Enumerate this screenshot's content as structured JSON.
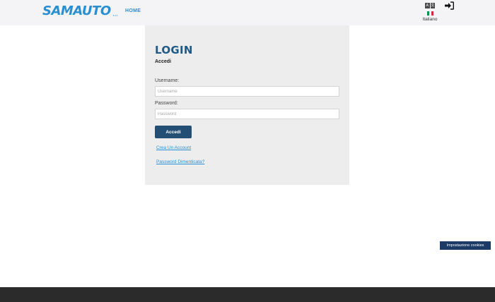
{
  "header": {
    "logo_text": "SAMAUTO",
    "logo_suffix": "s.r.l.",
    "nav_home": "HOME",
    "language": {
      "icon": "translate-icon",
      "label": "Italiano",
      "flag_colors": [
        "#009246",
        "#ffffff",
        "#ce2b37"
      ]
    },
    "login_icon": "sign-in-icon"
  },
  "login": {
    "title": "LOGIN",
    "subtitle": "Accedi",
    "username_label": "Username:",
    "username_placeholder": "Username",
    "password_label": "Password:",
    "password_placeholder": "Password",
    "submit_label": "Accedi",
    "create_account_link": "Crea Un Account",
    "forgot_password_link": "Password Dimenticata?"
  },
  "cookie_button": "Impostazione cookies",
  "colors": {
    "brand_blue": "#2a8fd0",
    "title_blue": "#1e5a86",
    "button_dark": "#244f74",
    "cookie_navy": "#1b3a66",
    "footer_bg": "#2b2b2b"
  }
}
